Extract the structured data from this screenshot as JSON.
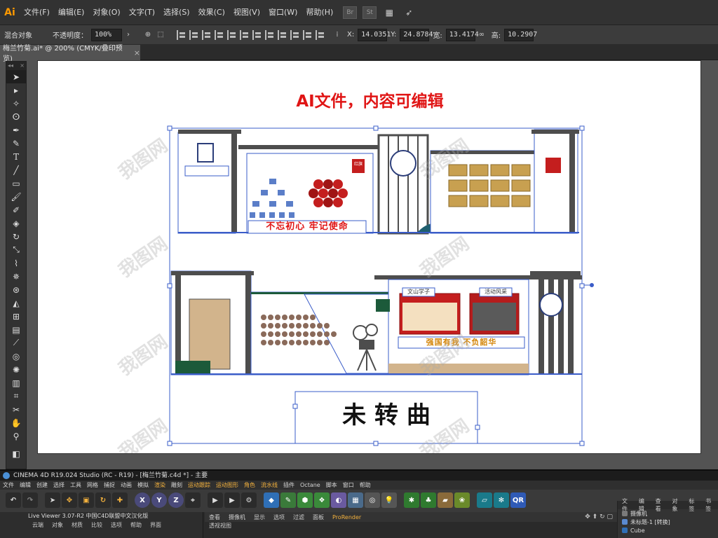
{
  "illustrator": {
    "logo": "Ai",
    "menu": [
      "文件(F)",
      "编辑(E)",
      "对象(O)",
      "文字(T)",
      "选择(S)",
      "效果(C)",
      "视图(V)",
      "窗口(W)",
      "帮助(H)"
    ],
    "bar_icons": [
      "Br",
      "St"
    ],
    "control": {
      "selection_label": "混合对象",
      "opacity_label": "不透明度：",
      "opacity_value": "100%",
      "x_label": "X:",
      "x_value": "14.0351",
      "y_label": "Y:",
      "y_value": "24.8784",
      "w_label": "宽:",
      "w_value": "13.4174",
      "h_label": "高:",
      "h_value": "10.2907"
    },
    "document_tab": {
      "title": "梅兰竹菊.ai* @ 200% (CMYK/叠印预览)",
      "close": "×"
    },
    "tools_head": [
      "◂◂",
      "×"
    ]
  },
  "artboard": {
    "headline": "AI文件，内容可编辑",
    "slogan_top": "不忘初心 牢记使命",
    "slogan_bottom": "强国有我 不负韶华",
    "title_bottom": "未 转 曲",
    "panel_labels": [
      "文山学子",
      "活动风采"
    ],
    "small_sign": "红旗",
    "watermark_text": "我图网"
  },
  "c4d": {
    "title": "CINEMA 4D R19.024 Studio (RC - R19) - [梅兰竹菊.c4d *] - 主要",
    "menu": [
      "文件",
      "编辑",
      "创建",
      "选择",
      "工具",
      "网格",
      "捕捉",
      "动画",
      "模拟",
      "渲染",
      "雕刻",
      "运动跟踪",
      "运动图形",
      "角色",
      "流水线",
      "插件",
      "Octane",
      "脚本",
      "窗口",
      "帮助"
    ],
    "highlight_menus": [
      "渲染",
      "运动跟踪",
      "运动图形",
      "角色",
      "流水线"
    ],
    "viewer_label": "Live Viewer 3.07-R2 中国C4D联盟中文汉化版",
    "viewer_tabs": [
      "云端",
      "对象",
      "材质",
      "比较",
      "选项",
      "帮助",
      "界面"
    ],
    "view_tabs": [
      "查看",
      "摄像机",
      "显示",
      "选项",
      "过滤",
      "面板",
      "ProRender"
    ],
    "view_subtab": "透视视图",
    "object_tabs": [
      "文件",
      "编辑",
      "查看",
      "对象",
      "标签",
      "书签"
    ],
    "objects": [
      "摄像机",
      "未标题-1 [转换]",
      "Cube"
    ],
    "axis_buttons": [
      "X",
      "Y",
      "Z"
    ]
  },
  "colors": {
    "ai_orange": "#ff9a00",
    "headline_red": "#e01515",
    "selection_blue": "#3a5cc8",
    "wall_gray": "#4d4d4d",
    "wood_tan": "#d2b48c",
    "c4d_orange": "#f3b13d"
  }
}
